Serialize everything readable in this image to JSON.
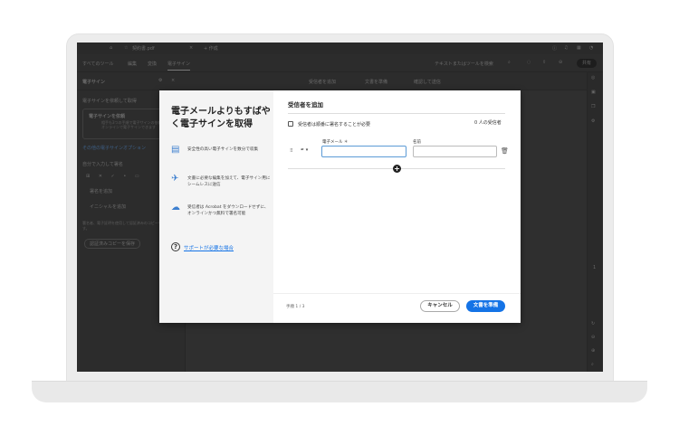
{
  "app": {
    "tab_title": "契約書.pdf",
    "new_tab": "+ 作成",
    "menu": [
      "すべてのツール",
      "編集",
      "変換",
      "電子サイン"
    ],
    "search_placeholder": "テキストまたはツールを検索",
    "share_button": "共有",
    "steps": [
      "受信者を追加",
      "文書を準備",
      "確認して送信"
    ],
    "panel_title": "電子サイン",
    "panel_subtitle": "電子サインを依頼して取得",
    "request_card_title": "電子サインを依頼",
    "request_card_desc": "相手も3つの手順で電子サインの依頼を送信してオンラインで電子サインできます",
    "panel_link": "その他の電子サインオプション",
    "self_sign_label": "自分で入力して署名",
    "add_signature": "署名を追加",
    "add_initials": "イニシャルを追加",
    "certified_desc": "署名者、電子証明を使用して認証済みのコピーを作成できます。",
    "certified_button": "認証済みコピーを保存",
    "page_indicator": "1"
  },
  "modal": {
    "heading": "電子メールよりもすばやく電子サインを取得",
    "features": [
      {
        "icon": "secure-document-icon",
        "text": "安全性の高い電子サインを数分で収集"
      },
      {
        "icon": "send-document-icon",
        "text": "文書に必要な編集を加えて、電子サイン用にシームレスに送信"
      },
      {
        "icon": "cloud-icon",
        "text": "受信者は Acrobat をダウンロードせずに、オンラインかつ無料で署名可能"
      }
    ],
    "help_link": "サポートが必要な場合",
    "title": "受信者を追加",
    "order_checkbox": "受信者は順番に署名することが必要",
    "recipient_count": "0 人の受信者",
    "email_label": "電子メール ＊",
    "name_label": "名前",
    "email_value": "",
    "name_value": "",
    "step_text": "手順 1 / 3",
    "cancel": "キャンセル",
    "prepare": "文書を準備"
  },
  "colors": {
    "accent": "#1473e6",
    "focus": "#5c9bd6"
  }
}
